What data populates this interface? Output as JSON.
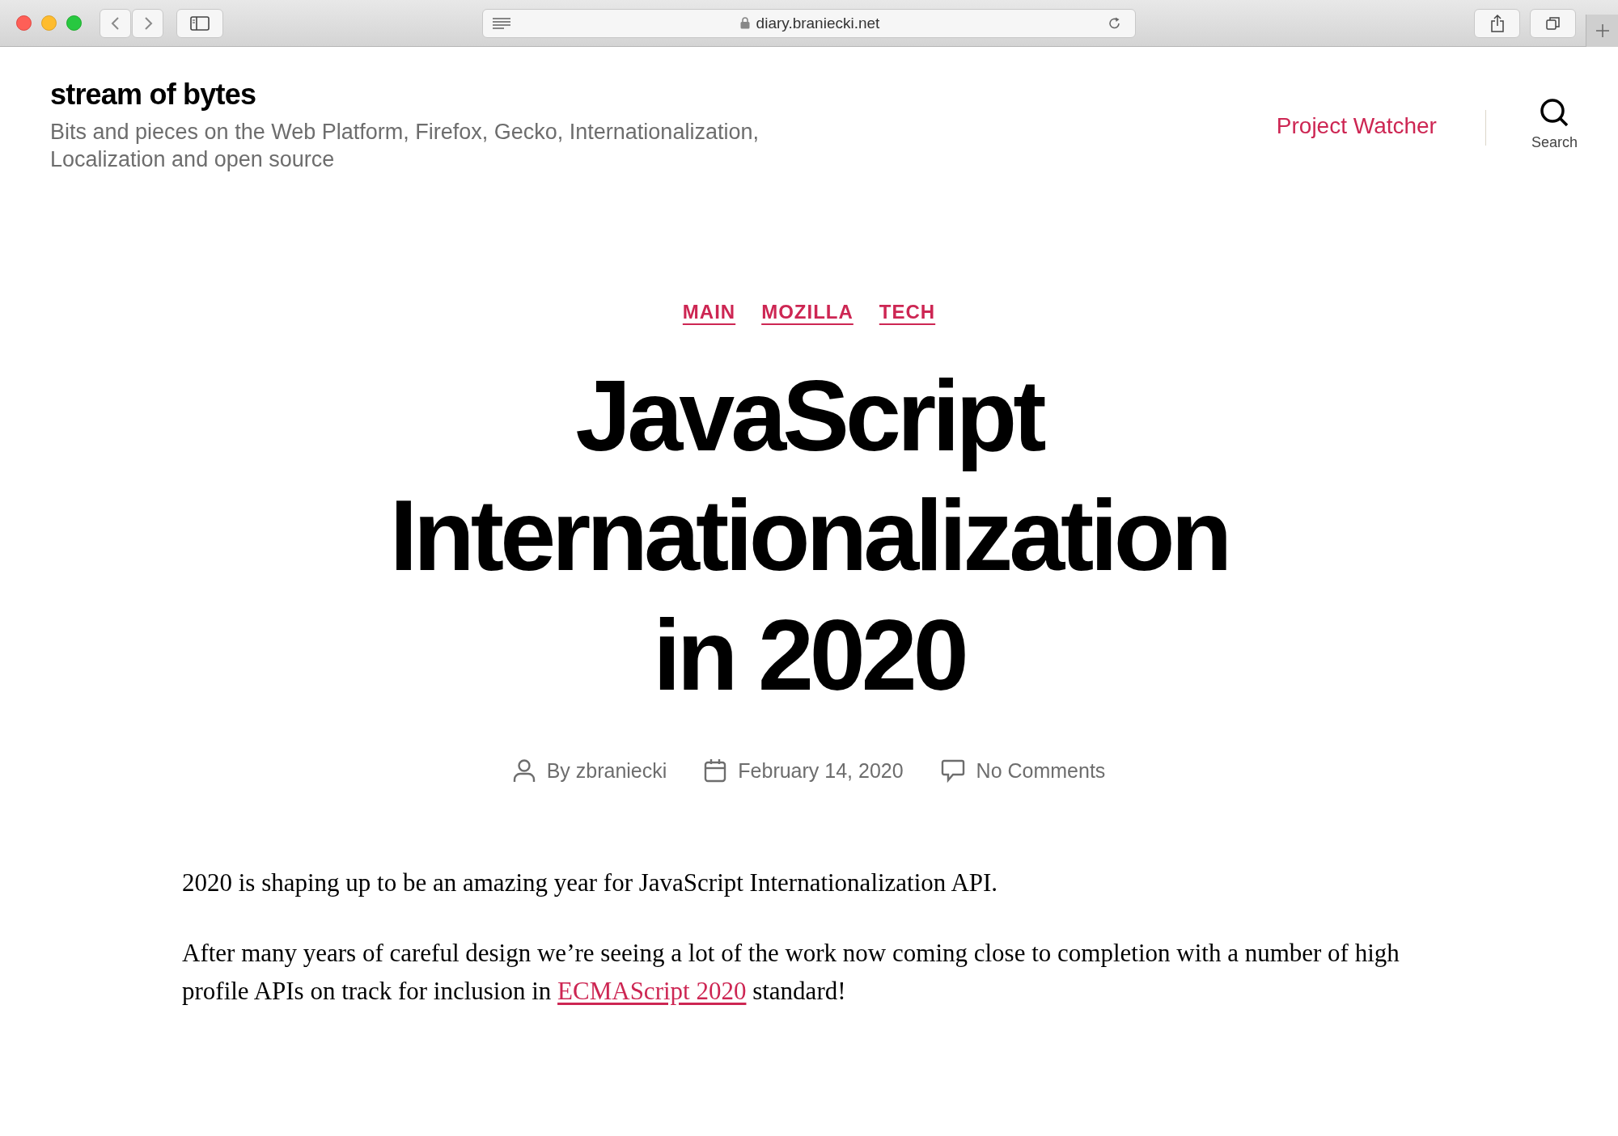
{
  "browser": {
    "url": "diary.braniecki.net"
  },
  "site": {
    "title": "stream of bytes",
    "tagline": "Bits and pieces on the Web Platform, Firefox, Gecko, Internationalization, Localization and open source"
  },
  "nav": {
    "link": "Project Watcher",
    "search_label": "Search"
  },
  "post": {
    "categories": [
      "MAIN",
      "MOZILLA",
      "TECH"
    ],
    "title_lines": [
      "JavaScript",
      "Internationalization",
      "in 2020"
    ],
    "meta": [
      {
        "kind": "author",
        "text": "By zbraniecki"
      },
      {
        "kind": "date",
        "text": "February 14, 2020"
      },
      {
        "kind": "comments",
        "text": "No Comments"
      }
    ],
    "paragraphs": [
      {
        "text": "2020 is shaping up to be an amazing year for JavaScript Internationalization API."
      },
      {
        "text": "After many years of careful design we’re seeing a lot of the work now coming close to completion with a number of high profile APIs on track for inclusion in ",
        "link": "ECMAScript 2020",
        "after": " standard!"
      }
    ]
  }
}
